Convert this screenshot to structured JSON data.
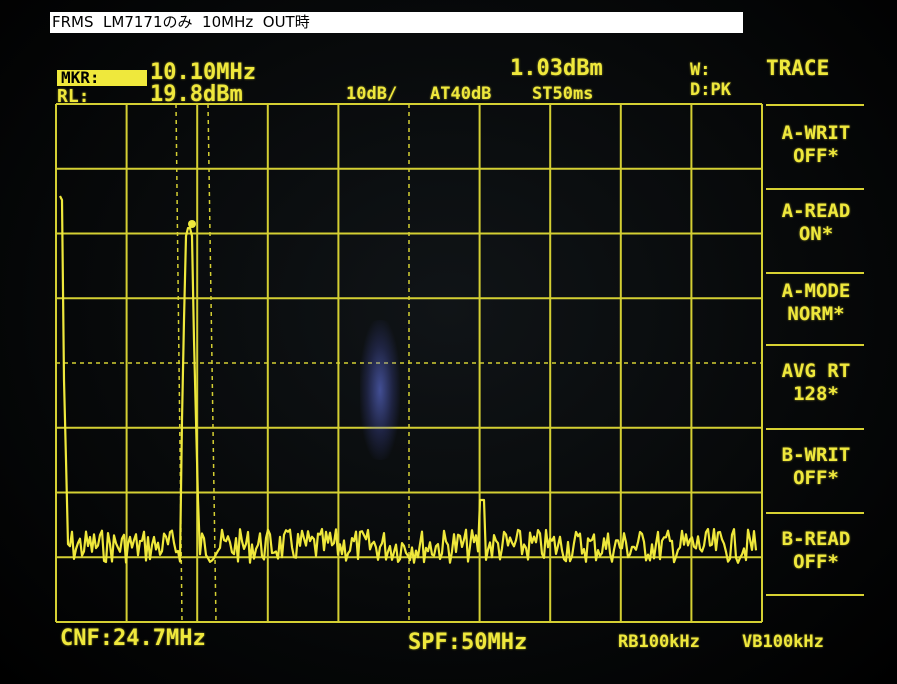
{
  "caption": "FRMS  LM7171のみ  10MHz  OUT時",
  "marker": {
    "label": "MKR:",
    "frequency": "10.10MHz",
    "level": "1.03dBm"
  },
  "reference": {
    "label": "RL:",
    "value": "19.8dBm"
  },
  "settings": {
    "scale": "10dB/",
    "attenuation": "AT40dB",
    "sweep": "ST50ms"
  },
  "mode": {
    "w": "W:",
    "detector": "D:PK"
  },
  "menu": {
    "title": "TRACE",
    "softkeys": [
      {
        "line1": "A-WRIT",
        "line2": "OFF*"
      },
      {
        "line1": "A-READ",
        "line2": "ON*"
      },
      {
        "line1": "A-MODE",
        "line2": "NORM*"
      },
      {
        "line1": "AVG RT",
        "line2": "128*"
      },
      {
        "line1": "B-WRIT",
        "line2": "OFF*"
      },
      {
        "line1": "B-READ",
        "line2": "OFF*"
      }
    ]
  },
  "footer": {
    "center_freq": "CNF:24.7MHz",
    "span": "SPF:50MHz",
    "rbw": "RB100kHz",
    "vbw": "VB100kHz"
  },
  "display": {
    "trace_color": "#efe83c",
    "grid_color": "#d4cf33",
    "background": "#07090a"
  }
}
